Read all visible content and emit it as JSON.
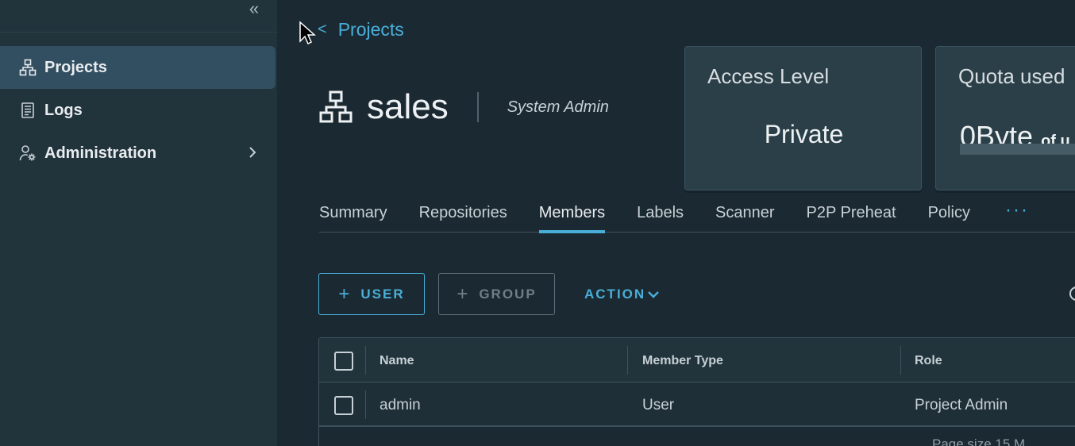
{
  "sidebar": {
    "collapse_label": "«",
    "items": [
      {
        "label": "Projects",
        "icon": "projects-icon",
        "active": true
      },
      {
        "label": "Logs",
        "icon": "logs-icon",
        "active": false
      },
      {
        "label": "Administration",
        "icon": "administration-icon",
        "active": false,
        "has_chevron": true
      }
    ]
  },
  "breadcrumb": {
    "back_glyph": "<",
    "label": "Projects"
  },
  "project": {
    "name": "sales",
    "role": "System Admin"
  },
  "cards": {
    "access_level": {
      "title": "Access Level",
      "value": "Private"
    },
    "quota": {
      "title": "Quota used",
      "value": "0Byte",
      "suffix": "of u"
    }
  },
  "tabs": [
    "Summary",
    "Repositories",
    "Members",
    "Labels",
    "Scanner",
    "P2P Preheat",
    "Policy"
  ],
  "active_tab": "Members",
  "tab_more": "···",
  "actions": {
    "user": "USER",
    "group": "GROUP",
    "action": "ACTION",
    "plus": "+"
  },
  "table": {
    "columns": [
      "Name",
      "Member Type",
      "Role"
    ],
    "rows": [
      {
        "name": "admin",
        "member_type": "User",
        "role": "Project Admin"
      }
    ],
    "footer": "Page size  15  M"
  },
  "colors": {
    "accent": "#49afd9",
    "background": "#1b2a32",
    "sidebar": "#21333b",
    "active_nav": "#324f61"
  }
}
